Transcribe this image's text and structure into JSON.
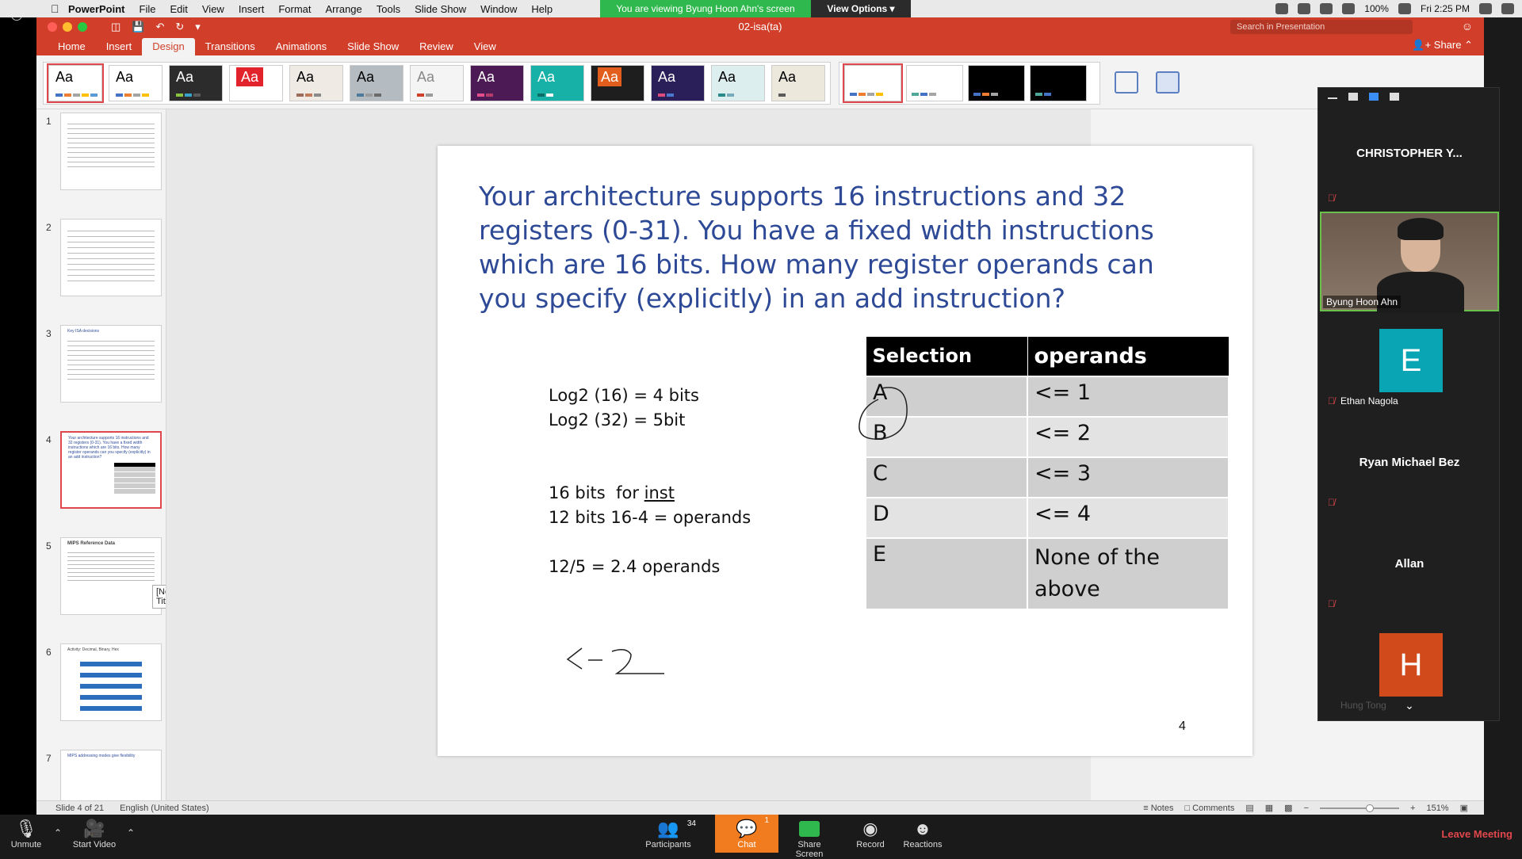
{
  "menubar": {
    "app_name": "PowerPoint",
    "items": [
      "File",
      "Edit",
      "View",
      "Insert",
      "Format",
      "Arrange",
      "Tools",
      "Slide Show",
      "Window",
      "Help"
    ],
    "zoom_banner": "You are viewing Byung Hoon Ahn's screen",
    "view_options": "View Options",
    "battery": "100%",
    "clock": "Fri 2:25 PM"
  },
  "window": {
    "doc_title": "02-isa(ta)",
    "search_placeholder": "Search in Presentation",
    "share_label": "Share",
    "tabs": [
      "Home",
      "Insert",
      "Design",
      "Transitions",
      "Animations",
      "Slide Show",
      "Review",
      "View"
    ],
    "active_tab": "Design"
  },
  "thumbnails": {
    "numbers": [
      "1",
      "2",
      "3",
      "4",
      "5",
      "6",
      "7"
    ],
    "slide3_title": "Key ISA decisions",
    "slide4_text": "Your architecture supports 16 instructions and 32 registers (0-31). You have a fixed width instructions which are 16 bits. How many register operands can you specify (explicitly) in an add instruction?",
    "slide5_title": "MIPS Reference Data",
    "slide6_title": "Activity: Decimal, Binary, Hex",
    "slide7_title": "MIPS addressing modes give flexibility",
    "tooltip": "[No Title]"
  },
  "slide": {
    "title": "Your architecture supports 16 instructions and 32 registers (0-31).  You have a fixed width instructions which are 16 bits.  How many register operands can you specify (explicitly) in an add instruction?",
    "work": {
      "line1": "Log2 (16) = 4 bits",
      "line2": "Log2 (32) = 5bit",
      "line3a": "16 bits  for ",
      "line3b": "inst",
      "line4": "12 bits 16-4 = operands",
      "line5": "12/5 = 2.4 operands"
    },
    "table": {
      "headers": [
        "Selection",
        "operands"
      ],
      "rows": [
        {
          "sel": "A",
          "op": "<= 1"
        },
        {
          "sel": "B",
          "op": "<= 2"
        },
        {
          "sel": "C",
          "op": "<= 3"
        },
        {
          "sel": "D",
          "op": "<= 4"
        },
        {
          "sel": "E",
          "op": "None of the above"
        }
      ]
    },
    "page_number": "4"
  },
  "statusbar": {
    "slide_info": "Slide 4 of 21",
    "language": "English (United States)",
    "notes": "Notes",
    "comments": "Comments",
    "zoom": "151%"
  },
  "participants": {
    "p1": "CHRISTOPHER  Y...",
    "p2": "Byung Hoon Ahn",
    "p3_initial": "E",
    "p3": "Ethan Nagola",
    "p4": "Ryan Michael Bez",
    "p5": "Allan",
    "p6_initial": "H",
    "p6": "Hung Tong"
  },
  "zoom_toolbar": {
    "unmute": "Unmute",
    "start_video": "Start Video",
    "participants": "Participants",
    "participants_count": "34",
    "chat": "Chat",
    "chat_badge": "1",
    "share_screen": "Share Screen",
    "record": "Record",
    "reactions": "Reactions",
    "leave": "Leave Meeting"
  },
  "colors": {
    "ppt_accent": "#d13f2a",
    "title_blue": "#2e4a97",
    "zoom_green": "#2fb84d",
    "chat_orange": "#f07c1f",
    "avatar_teal": "#0aa5b5",
    "avatar_orange": "#d04a1c"
  }
}
